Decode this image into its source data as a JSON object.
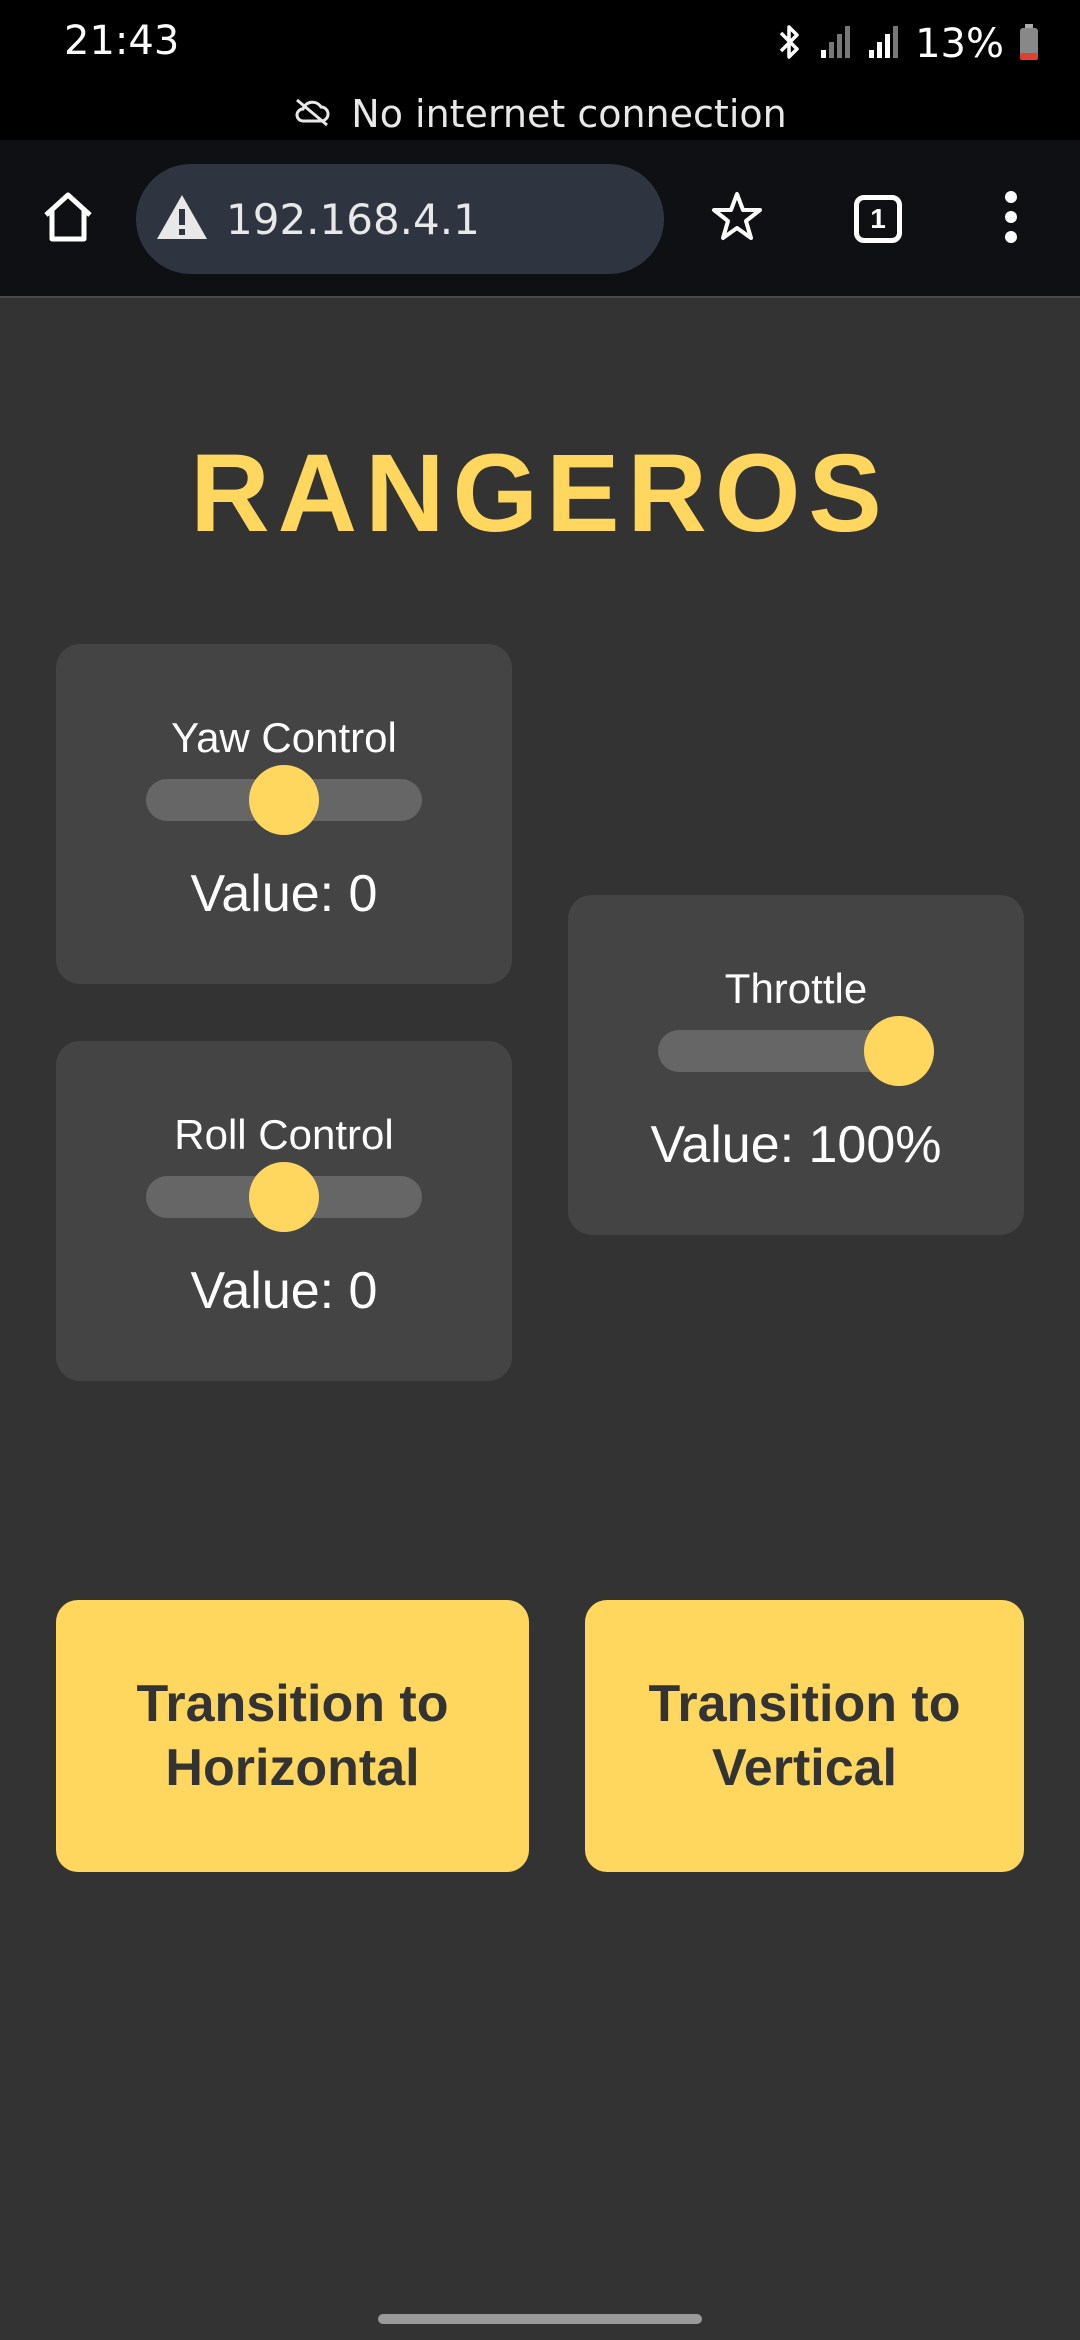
{
  "status_bar": {
    "time": "21:43",
    "battery": "13%",
    "icons": [
      "bluetooth-icon",
      "signal-icon",
      "signal-icon",
      "battery-icon"
    ]
  },
  "banner": {
    "text": "No internet connection",
    "icon": "cloud-off-icon"
  },
  "browser": {
    "url": "192.168.4.1",
    "tab_count": "1",
    "icons": [
      "home-icon",
      "warning-icon",
      "star-icon",
      "tabs-icon",
      "more-icon"
    ]
  },
  "page": {
    "title": "RANGEROS",
    "accent_color": "#ffd75e",
    "background_color": "#333333",
    "controls": {
      "yaw": {
        "label": "Yaw Control",
        "value_text": "Value: 0",
        "position": 0.5
      },
      "roll": {
        "label": "Roll Control",
        "value_text": "Value: 0",
        "position": 0.5
      },
      "throttle": {
        "label": "Throttle",
        "value_text": "Value: 100%",
        "position": 1.0
      }
    },
    "buttons": {
      "horizontal": "Transition to Horizontal",
      "vertical": "Transition to Vertical"
    }
  }
}
